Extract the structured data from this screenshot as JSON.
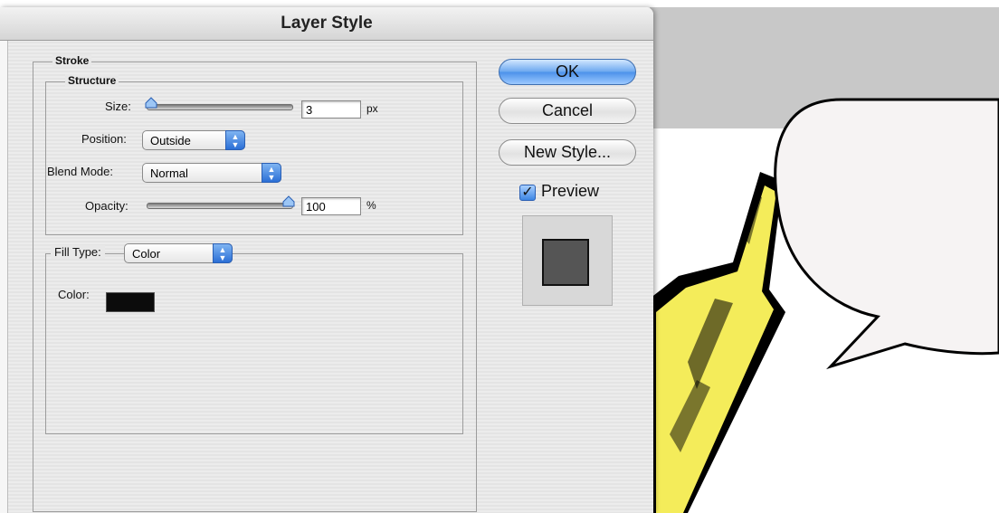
{
  "dialog": {
    "title": "Layer Style",
    "stroke_legend": "Stroke",
    "structure_legend": "Structure",
    "size": {
      "label": "Size:",
      "value": "3",
      "unit": "px",
      "slider_fraction": 0.03
    },
    "position": {
      "label": "Position:",
      "selected": "Outside"
    },
    "blend_mode": {
      "label": "Blend Mode:",
      "selected": "Normal"
    },
    "opacity": {
      "label": "Opacity:",
      "value": "100",
      "unit": "%",
      "slider_fraction": 1.0
    },
    "fill_type": {
      "label": "Fill Type:",
      "selected": "Color"
    },
    "color": {
      "label": "Color:",
      "value": "#0c0c0c"
    },
    "buttons": {
      "ok": "OK",
      "cancel": "Cancel",
      "new_style": "New Style..."
    },
    "preview": {
      "label": "Preview",
      "checked": true
    }
  },
  "canvas": {
    "background_band_color": "#c8c8c8",
    "bottle_fill_color": "#f4ec5a",
    "speech_bubble_fill": "#f6f3f3"
  }
}
